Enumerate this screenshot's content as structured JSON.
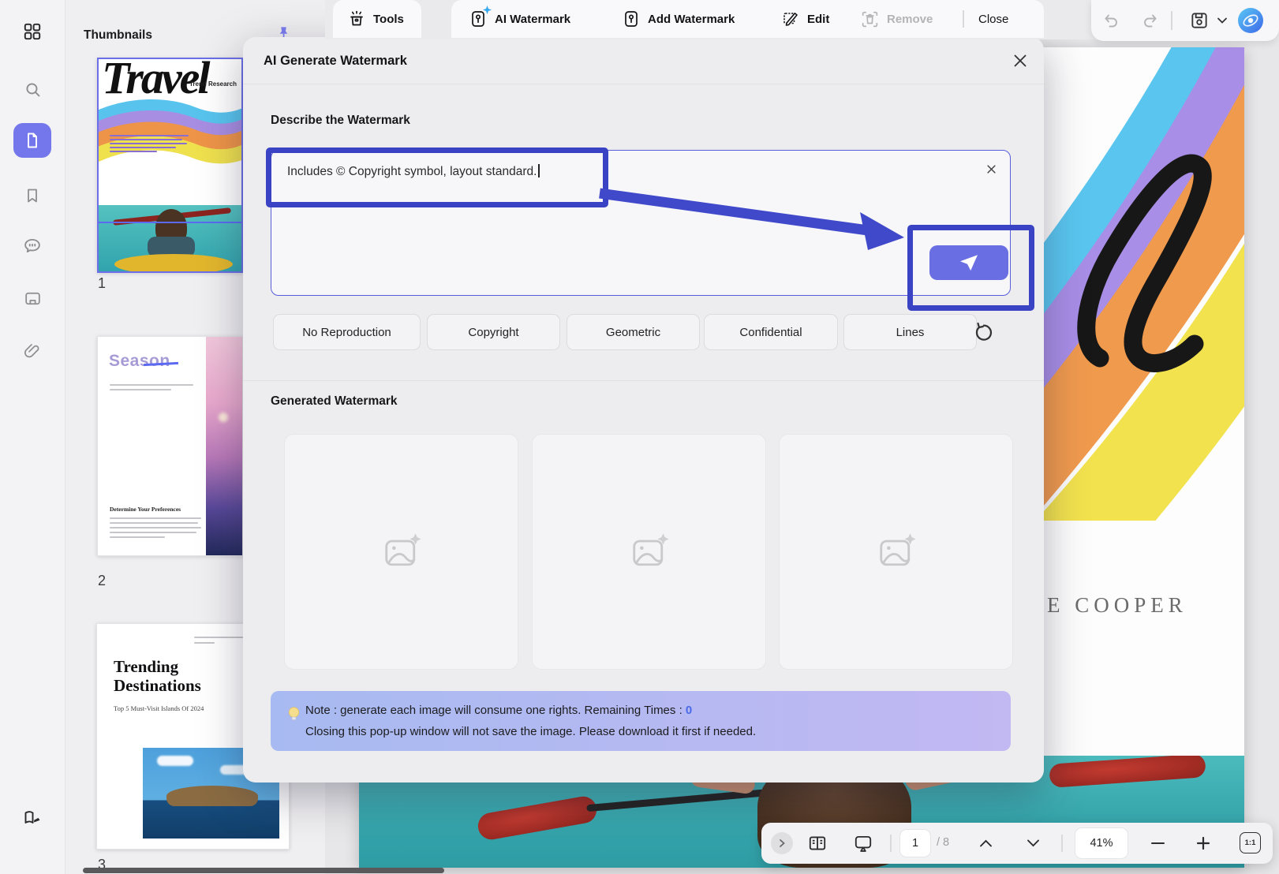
{
  "window": {
    "panel_title": "Thumbnails",
    "tabs": {
      "tools": "Tools",
      "ai_watermark": "AI Watermark",
      "add_watermark": "Add Watermark",
      "edit": "Edit",
      "remove": "Remove",
      "close": "Close"
    }
  },
  "thumbnails": {
    "pages": [
      {
        "number": "1",
        "kicker": "Trend Research",
        "script_title": "Travel"
      },
      {
        "number": "2",
        "title": "Season",
        "heading": "Determine Your Preferences"
      },
      {
        "number": "3",
        "title_line1": "Trending",
        "title_line2": "Destinations",
        "subtitle": "Top 5 Must-Visit Islands Of 2024"
      }
    ]
  },
  "dialog": {
    "title": "AI Generate Watermark",
    "describe_label": "Describe the Watermark",
    "prompt_text": "Includes © Copyright symbol, layout standard.",
    "presets": [
      "No Reproduction",
      "Copyright",
      "Geometric",
      "Confidential",
      "Lines"
    ],
    "generated_label": "Generated Watermark",
    "note_line1_prefix": "Note : generate each image will consume one rights. Remaining Times : ",
    "note_remaining_times": "0",
    "note_line2": "Closing this pop-up window will not save the image. Please download it first if needed."
  },
  "document": {
    "author_text": "E COOPER"
  },
  "bottom_bar": {
    "current_page": "1",
    "total_pages": "/ 8",
    "zoom_level": "41%",
    "fit_label": "1:1"
  },
  "colors": {
    "accent": "#6A6EE3",
    "annotation_blue": "#3A43C4",
    "active_tool": "#7477EB",
    "remaining_times": "#4A6BE8"
  }
}
